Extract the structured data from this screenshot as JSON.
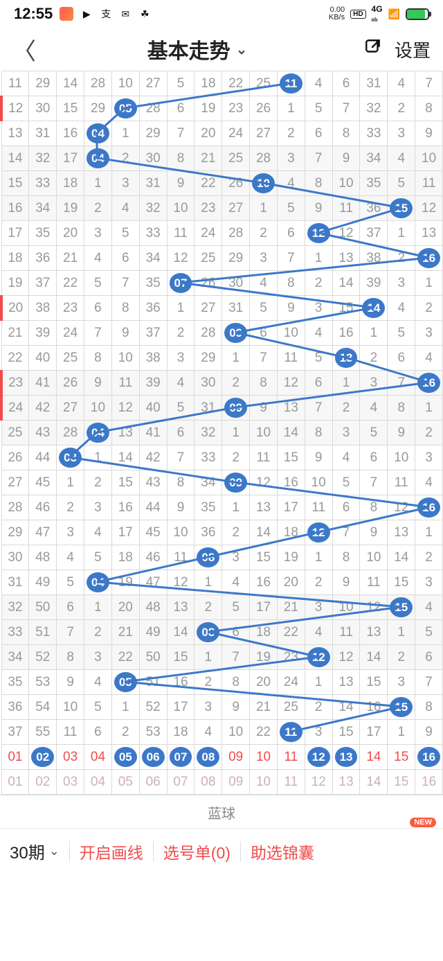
{
  "status": {
    "time": "12:55",
    "kb_rate": "0.00",
    "kb_unit": "KB/s",
    "hd": "HD",
    "net": "4G",
    "signal": "ıılı"
  },
  "header": {
    "title": "基本走势",
    "settings": "设置"
  },
  "footer": {
    "period": "30期",
    "draw_line": "开启画线",
    "pick_list": "选号单(0)",
    "assist": "助选锦囊",
    "new": "NEW"
  },
  "blue_label": "蓝球",
  "chart_data": {
    "type": "table",
    "title": "蓝球 基本走势 (Blue Ball Trend)",
    "columns": 16,
    "rows": [
      {
        "cells": [
          11,
          29,
          14,
          28,
          10,
          27,
          5,
          18,
          22,
          25,
          "b11",
          4,
          6,
          31,
          4,
          7
        ],
        "hl": 11
      },
      {
        "cells": [
          12,
          30,
          15,
          29,
          "b05",
          28,
          6,
          19,
          23,
          26,
          1,
          5,
          7,
          32,
          2,
          8
        ],
        "hl": 5,
        "red": true
      },
      {
        "cells": [
          13,
          31,
          16,
          "b04",
          1,
          29,
          7,
          20,
          24,
          27,
          2,
          6,
          8,
          33,
          3,
          9
        ],
        "hl": 4
      },
      {
        "cells": [
          14,
          32,
          17,
          "b04",
          2,
          30,
          8,
          21,
          25,
          28,
          3,
          7,
          9,
          34,
          4,
          10
        ],
        "hl": 4
      },
      {
        "cells": [
          15,
          33,
          18,
          1,
          3,
          31,
          9,
          22,
          26,
          "b10",
          4,
          8,
          10,
          35,
          5,
          11
        ],
        "hl": 10
      },
      {
        "cells": [
          16,
          34,
          19,
          2,
          4,
          32,
          10,
          23,
          27,
          1,
          5,
          9,
          11,
          36,
          "b15",
          12
        ],
        "hl": 15
      },
      {
        "cells": [
          17,
          35,
          20,
          3,
          5,
          33,
          11,
          24,
          28,
          2,
          6,
          "b12",
          12,
          37,
          1,
          13
        ],
        "hl": 12
      },
      {
        "cells": [
          18,
          36,
          21,
          4,
          6,
          34,
          12,
          25,
          29,
          3,
          7,
          1,
          13,
          38,
          2,
          "b16"
        ],
        "hl": 16
      },
      {
        "cells": [
          19,
          37,
          22,
          5,
          7,
          35,
          "b07",
          26,
          30,
          4,
          8,
          2,
          14,
          39,
          3,
          1
        ],
        "hl": 7
      },
      {
        "cells": [
          20,
          38,
          23,
          6,
          8,
          36,
          1,
          27,
          31,
          5,
          9,
          3,
          15,
          "b14",
          4,
          2
        ],
        "hl": 14,
        "red": true
      },
      {
        "cells": [
          21,
          39,
          24,
          7,
          9,
          37,
          2,
          28,
          "b09",
          6,
          10,
          4,
          16,
          1,
          5,
          3
        ],
        "hl": 9
      },
      {
        "cells": [
          22,
          40,
          25,
          8,
          10,
          38,
          3,
          29,
          1,
          7,
          11,
          5,
          "b13",
          2,
          6,
          4
        ],
        "hl": 13
      },
      {
        "cells": [
          23,
          41,
          26,
          9,
          11,
          39,
          4,
          30,
          2,
          8,
          12,
          6,
          1,
          3,
          7,
          "b16"
        ],
        "hl": 16,
        "red": true
      },
      {
        "cells": [
          24,
          42,
          27,
          10,
          12,
          40,
          5,
          31,
          "b09",
          9,
          13,
          7,
          2,
          4,
          8,
          1
        ],
        "hl": 9,
        "red": true
      },
      {
        "cells": [
          25,
          43,
          28,
          "b04",
          13,
          41,
          6,
          32,
          1,
          10,
          14,
          8,
          3,
          5,
          9,
          2
        ],
        "hl": 4
      },
      {
        "cells": [
          26,
          44,
          "b03",
          1,
          14,
          42,
          7,
          33,
          2,
          11,
          15,
          9,
          4,
          6,
          10,
          3
        ],
        "hl": 3
      },
      {
        "cells": [
          27,
          45,
          1,
          2,
          15,
          43,
          8,
          34,
          "b09",
          12,
          16,
          10,
          5,
          7,
          11,
          4
        ],
        "hl": 9
      },
      {
        "cells": [
          28,
          46,
          2,
          3,
          16,
          44,
          9,
          35,
          1,
          13,
          17,
          11,
          6,
          8,
          12,
          "b16"
        ],
        "hl": 16
      },
      {
        "cells": [
          29,
          47,
          3,
          4,
          17,
          45,
          10,
          36,
          2,
          14,
          18,
          "b12",
          7,
          9,
          13,
          1
        ],
        "hl": 12
      },
      {
        "cells": [
          30,
          48,
          4,
          5,
          18,
          46,
          11,
          "b08",
          3,
          15,
          19,
          1,
          8,
          10,
          14,
          2
        ],
        "hl": 8
      },
      {
        "cells": [
          31,
          49,
          5,
          "b04",
          19,
          47,
          12,
          1,
          4,
          16,
          20,
          2,
          9,
          11,
          15,
          3
        ],
        "hl": 4
      },
      {
        "cells": [
          32,
          50,
          6,
          1,
          20,
          48,
          13,
          2,
          5,
          17,
          21,
          3,
          10,
          12,
          "b15",
          4
        ],
        "hl": 15
      },
      {
        "cells": [
          33,
          51,
          7,
          2,
          21,
          49,
          14,
          "b08",
          6,
          18,
          22,
          4,
          11,
          13,
          1,
          5
        ],
        "hl": 8
      },
      {
        "cells": [
          34,
          52,
          8,
          3,
          22,
          50,
          15,
          1,
          7,
          19,
          23,
          "b12",
          12,
          14,
          2,
          6
        ],
        "hl": 12
      },
      {
        "cells": [
          35,
          53,
          9,
          4,
          "b05",
          51,
          16,
          2,
          8,
          20,
          24,
          1,
          13,
          15,
          3,
          7
        ],
        "hl": 5
      },
      {
        "cells": [
          36,
          54,
          10,
          5,
          1,
          52,
          17,
          3,
          9,
          21,
          25,
          2,
          14,
          16,
          "b15",
          8
        ],
        "hl": 15
      },
      {
        "cells": [
          37,
          55,
          11,
          6,
          2,
          53,
          18,
          4,
          10,
          22,
          "b11",
          3,
          15,
          17,
          1,
          9
        ],
        "hl": 11
      }
    ],
    "footer_row_1": {
      "cells": [
        "01",
        "b02",
        "03",
        "04",
        "b05",
        "b06",
        "b07",
        "b08",
        "09",
        "10",
        "11",
        "b12",
        "b13",
        "14",
        "15",
        "b16"
      ]
    },
    "footer_row_2": {
      "cells": [
        "01",
        "02",
        "03",
        "04",
        "05",
        "06",
        "07",
        "08",
        "09",
        "10",
        "11",
        "12",
        "13",
        "14",
        "15",
        "16"
      ]
    }
  }
}
